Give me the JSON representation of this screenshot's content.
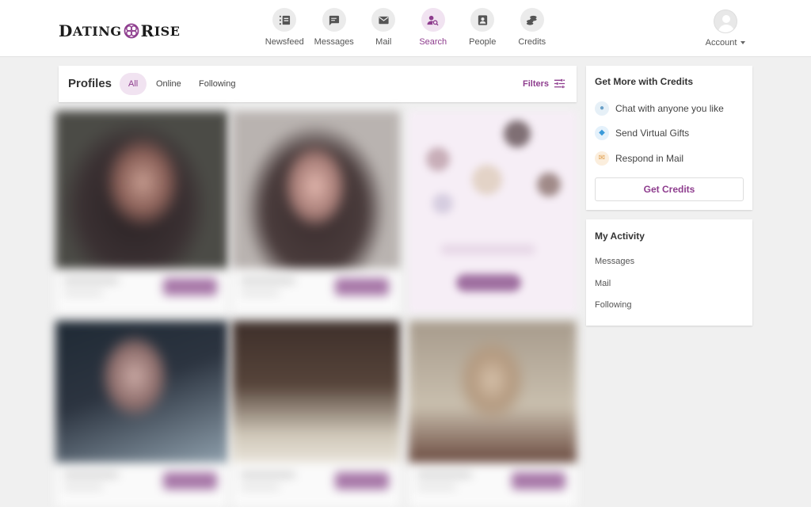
{
  "brand": {
    "logo_part1": "Dating",
    "logo_part2": "Rise",
    "accent_color": "#8e3d8e"
  },
  "nav": {
    "items": [
      {
        "label": "Newsfeed",
        "icon": "newsfeed-icon"
      },
      {
        "label": "Messages",
        "icon": "message-icon"
      },
      {
        "label": "Mail",
        "icon": "mail-icon"
      },
      {
        "label": "Search",
        "icon": "search-person-icon",
        "active": true
      },
      {
        "label": "People",
        "icon": "contact-card-icon"
      },
      {
        "label": "Credits",
        "icon": "coins-icon"
      }
    ],
    "account_label": "Account"
  },
  "profiles_bar": {
    "title": "Profiles",
    "tabs": [
      {
        "label": "All",
        "active": true
      },
      {
        "label": "Online"
      },
      {
        "label": "Following"
      }
    ],
    "filters_label": "Filters"
  },
  "sidebar": {
    "credits_panel": {
      "title": "Get More with Credits",
      "features": [
        {
          "label": "Chat with anyone you like",
          "icon": "chat-bubble-icon"
        },
        {
          "label": "Send Virtual Gifts",
          "icon": "diamond-icon"
        },
        {
          "label": "Respond in Mail",
          "icon": "envelope-icon"
        }
      ],
      "button_label": "Get Credits"
    },
    "activity_panel": {
      "title": "My Activity",
      "links": [
        "Messages",
        "Mail",
        "Following"
      ]
    }
  }
}
